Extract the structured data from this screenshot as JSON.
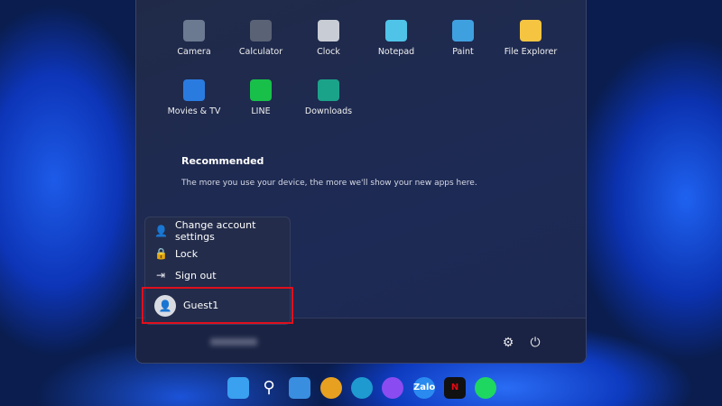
{
  "pinned_apps": [
    {
      "label": "Camera",
      "icon": "camera-icon",
      "color": "#6b7a90"
    },
    {
      "label": "Calculator",
      "icon": "calculator-icon",
      "color": "#5a6275"
    },
    {
      "label": "Clock",
      "icon": "clock-icon",
      "color": "#c8ccd4"
    },
    {
      "label": "Notepad",
      "icon": "notepad-icon",
      "color": "#4fc3e8"
    },
    {
      "label": "Paint",
      "icon": "paint-icon",
      "color": "#3fa0e0"
    },
    {
      "label": "File Explorer",
      "icon": "folder-icon",
      "color": "#f5c542"
    },
    {
      "label": "Movies & TV",
      "icon": "movies-icon",
      "color": "#2a7be0"
    },
    {
      "label": "LINE",
      "icon": "line-icon",
      "color": "#18c04a"
    },
    {
      "label": "Downloads",
      "icon": "downloads-icon",
      "color": "#1ba38a"
    }
  ],
  "recommended": {
    "title": "Recommended",
    "text": "The more you use your device, the more we'll show your new apps here."
  },
  "account_menu": {
    "items": [
      {
        "label": "Change account settings",
        "icon": "account-settings-icon"
      },
      {
        "label": "Lock",
        "icon": "lock-icon"
      },
      {
        "label": "Sign out",
        "icon": "sign-out-icon"
      }
    ],
    "user": "Guest1"
  },
  "footer": {
    "settings_icon": "gear-icon",
    "power_icon": "power-icon"
  },
  "highlight_color": "#e0101e",
  "taskbar": [
    {
      "icon": "start-icon",
      "text": ""
    },
    {
      "icon": "search-icon",
      "text": ""
    },
    {
      "icon": "widgets-icon",
      "text": ""
    },
    {
      "icon": "chrome-icon",
      "text": ""
    },
    {
      "icon": "edge-icon",
      "text": ""
    },
    {
      "icon": "messenger-icon",
      "text": ""
    },
    {
      "icon": "zalo-icon",
      "text": "Zalo"
    },
    {
      "icon": "netflix-icon",
      "text": "N"
    },
    {
      "icon": "spotify-icon",
      "text": ""
    }
  ]
}
